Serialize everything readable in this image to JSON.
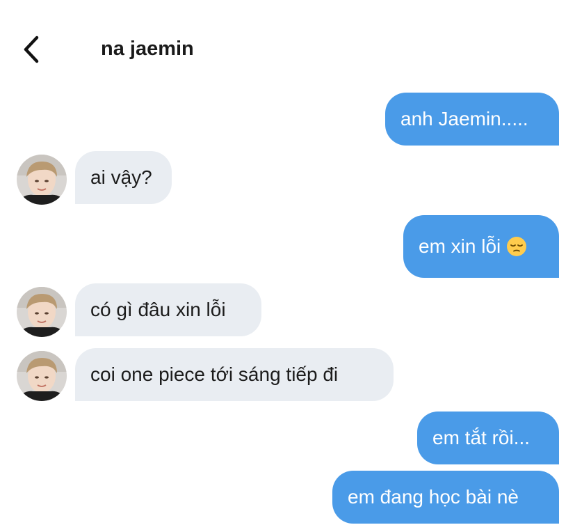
{
  "header": {
    "title": "na jaemin",
    "back_icon": "chevron-left-icon"
  },
  "messages": [
    {
      "side": "sent",
      "text": "anh Jaemin....."
    },
    {
      "side": "received",
      "text": "ai vậy?"
    },
    {
      "side": "sent",
      "text": "em xin lỗi",
      "emoji": "pensive-face"
    },
    {
      "side": "received",
      "text": "có gì đâu xin lỗi"
    },
    {
      "side": "received",
      "text": "coi one piece tới sáng tiếp đi"
    },
    {
      "side": "sent",
      "text": "em tắt rồi..."
    },
    {
      "side": "sent",
      "text": "em đang học bài nè"
    }
  ],
  "colors": {
    "sent_bubble": "#4a9be8",
    "received_bubble": "#e9edf2",
    "sent_text": "#ffffff",
    "received_text": "#1c1c1c"
  }
}
